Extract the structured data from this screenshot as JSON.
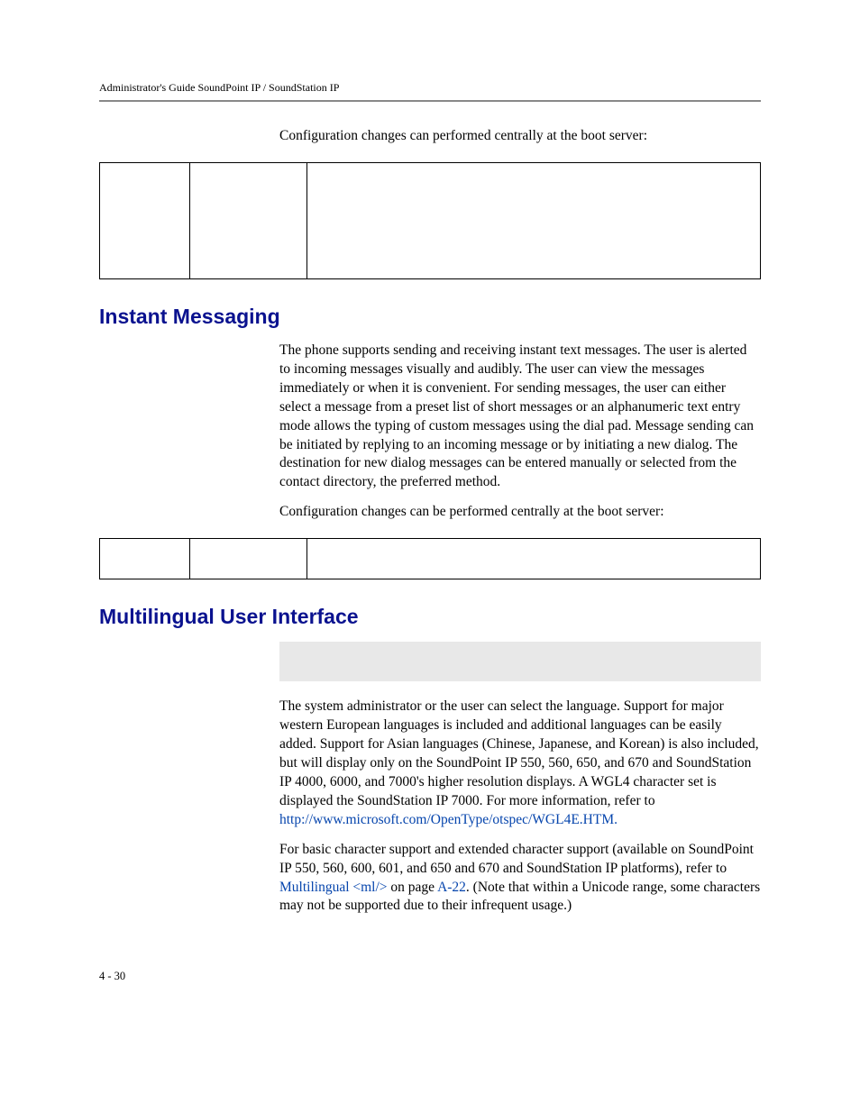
{
  "header": {
    "running_head": "Administrator's Guide SoundPoint IP / SoundStation IP"
  },
  "intro": {
    "para1": "Configuration changes can performed centrally at the boot server:"
  },
  "sections": {
    "im": {
      "title": "Instant Messaging",
      "para1": "The phone supports sending and receiving instant text messages. The user is alerted to incoming messages visually and audibly. The user can view the messages immediately or when it is convenient. For sending messages, the user can either select a message from a preset list of short messages or an alphanumeric text entry mode allows the typing of custom messages using the dial pad. Message sending can be initiated by replying to an incoming message or by initiating a new dialog. The destination for new dialog messages can be entered manually or selected from the contact directory, the preferred method.",
      "para2": "Configuration changes can be performed centrally at the boot server:"
    },
    "mui": {
      "title": "Multilingual User Interface",
      "para1_pre": "The system administrator or the user can select the language. Support for major western European languages is included and additional languages can be easily added. Support for Asian languages (Chinese, Japanese, and Korean) is also included, but will display only on the SoundPoint IP 550, 560, 650, and 670 and SoundStation IP 4000, 6000, and 7000's higher resolution displays. A WGL4 character set is displayed the SoundStation IP 7000. For more information, refer to ",
      "link1": "http://www.microsoft.com/OpenType/otspec/WGL4E.HTM.",
      "para2_a": "For basic character support and extended character support (available on SoundPoint IP 550, 560, 600, 601, and 650 and 670 and SoundStation IP platforms), refer to ",
      "xref1": "Multilingual <ml/>",
      "para2_b": " on page ",
      "xref2": "A-22",
      "para2_c": ". (Note that within a Unicode range, some characters may not be supported due to their infrequent usage.)"
    }
  },
  "footer": {
    "page": "4 - 30"
  }
}
